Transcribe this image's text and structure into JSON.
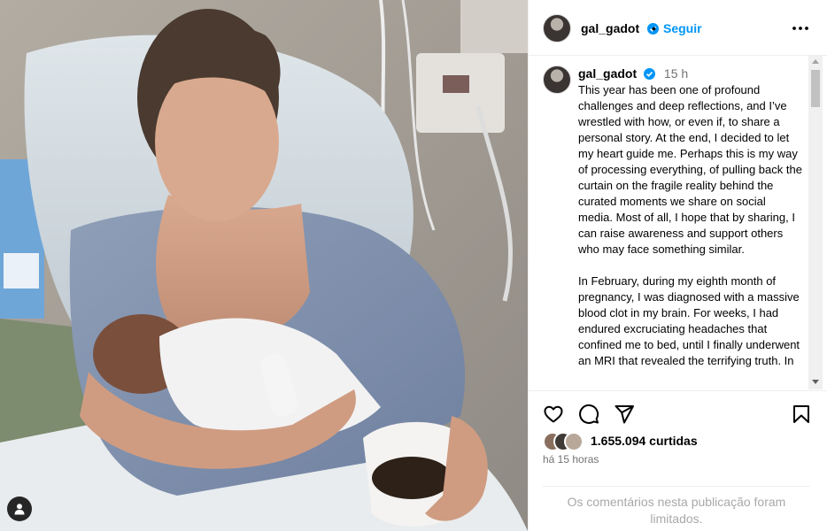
{
  "post": {
    "username": "gal_gadot",
    "separator": "•",
    "follow_label": "Seguir",
    "caption_time": "15 h",
    "caption_text": "This year has been one of profound challenges and deep reflections, and I’ve wrestled with how, or even if, to share a personal story. At the end, I decided to let my heart guide me. Perhaps this is my way of processing everything, of pulling back the curtain on the fragile reality behind the curated moments we share on social media. Most of all, I hope that by sharing, I can raise awareness and support others who may face something similar.\n\nIn February, during my eighth month of pregnancy, I was diagnosed with a massive blood clot in my brain. For weeks, I had endured excruciating headaches that confined me to bed, until I finally underwent an MRI that revealed the terrifying truth. In",
    "likes_text": "1.655.094 curtidas",
    "posted_ago": "há 15 horas",
    "comments_limited": "Os comentários nesta publicação foram limitados."
  },
  "icons": {
    "more": "more-options-icon",
    "like": "heart-icon",
    "comment": "comment-icon",
    "share": "send-icon",
    "save": "bookmark-icon",
    "verified": "verified-badge-icon",
    "user_tag": "user-tag-icon"
  },
  "colors": {
    "accent": "#0095f6",
    "secondary_text": "#737373",
    "muted_text": "#a8a8a8",
    "border": "#efefef"
  }
}
